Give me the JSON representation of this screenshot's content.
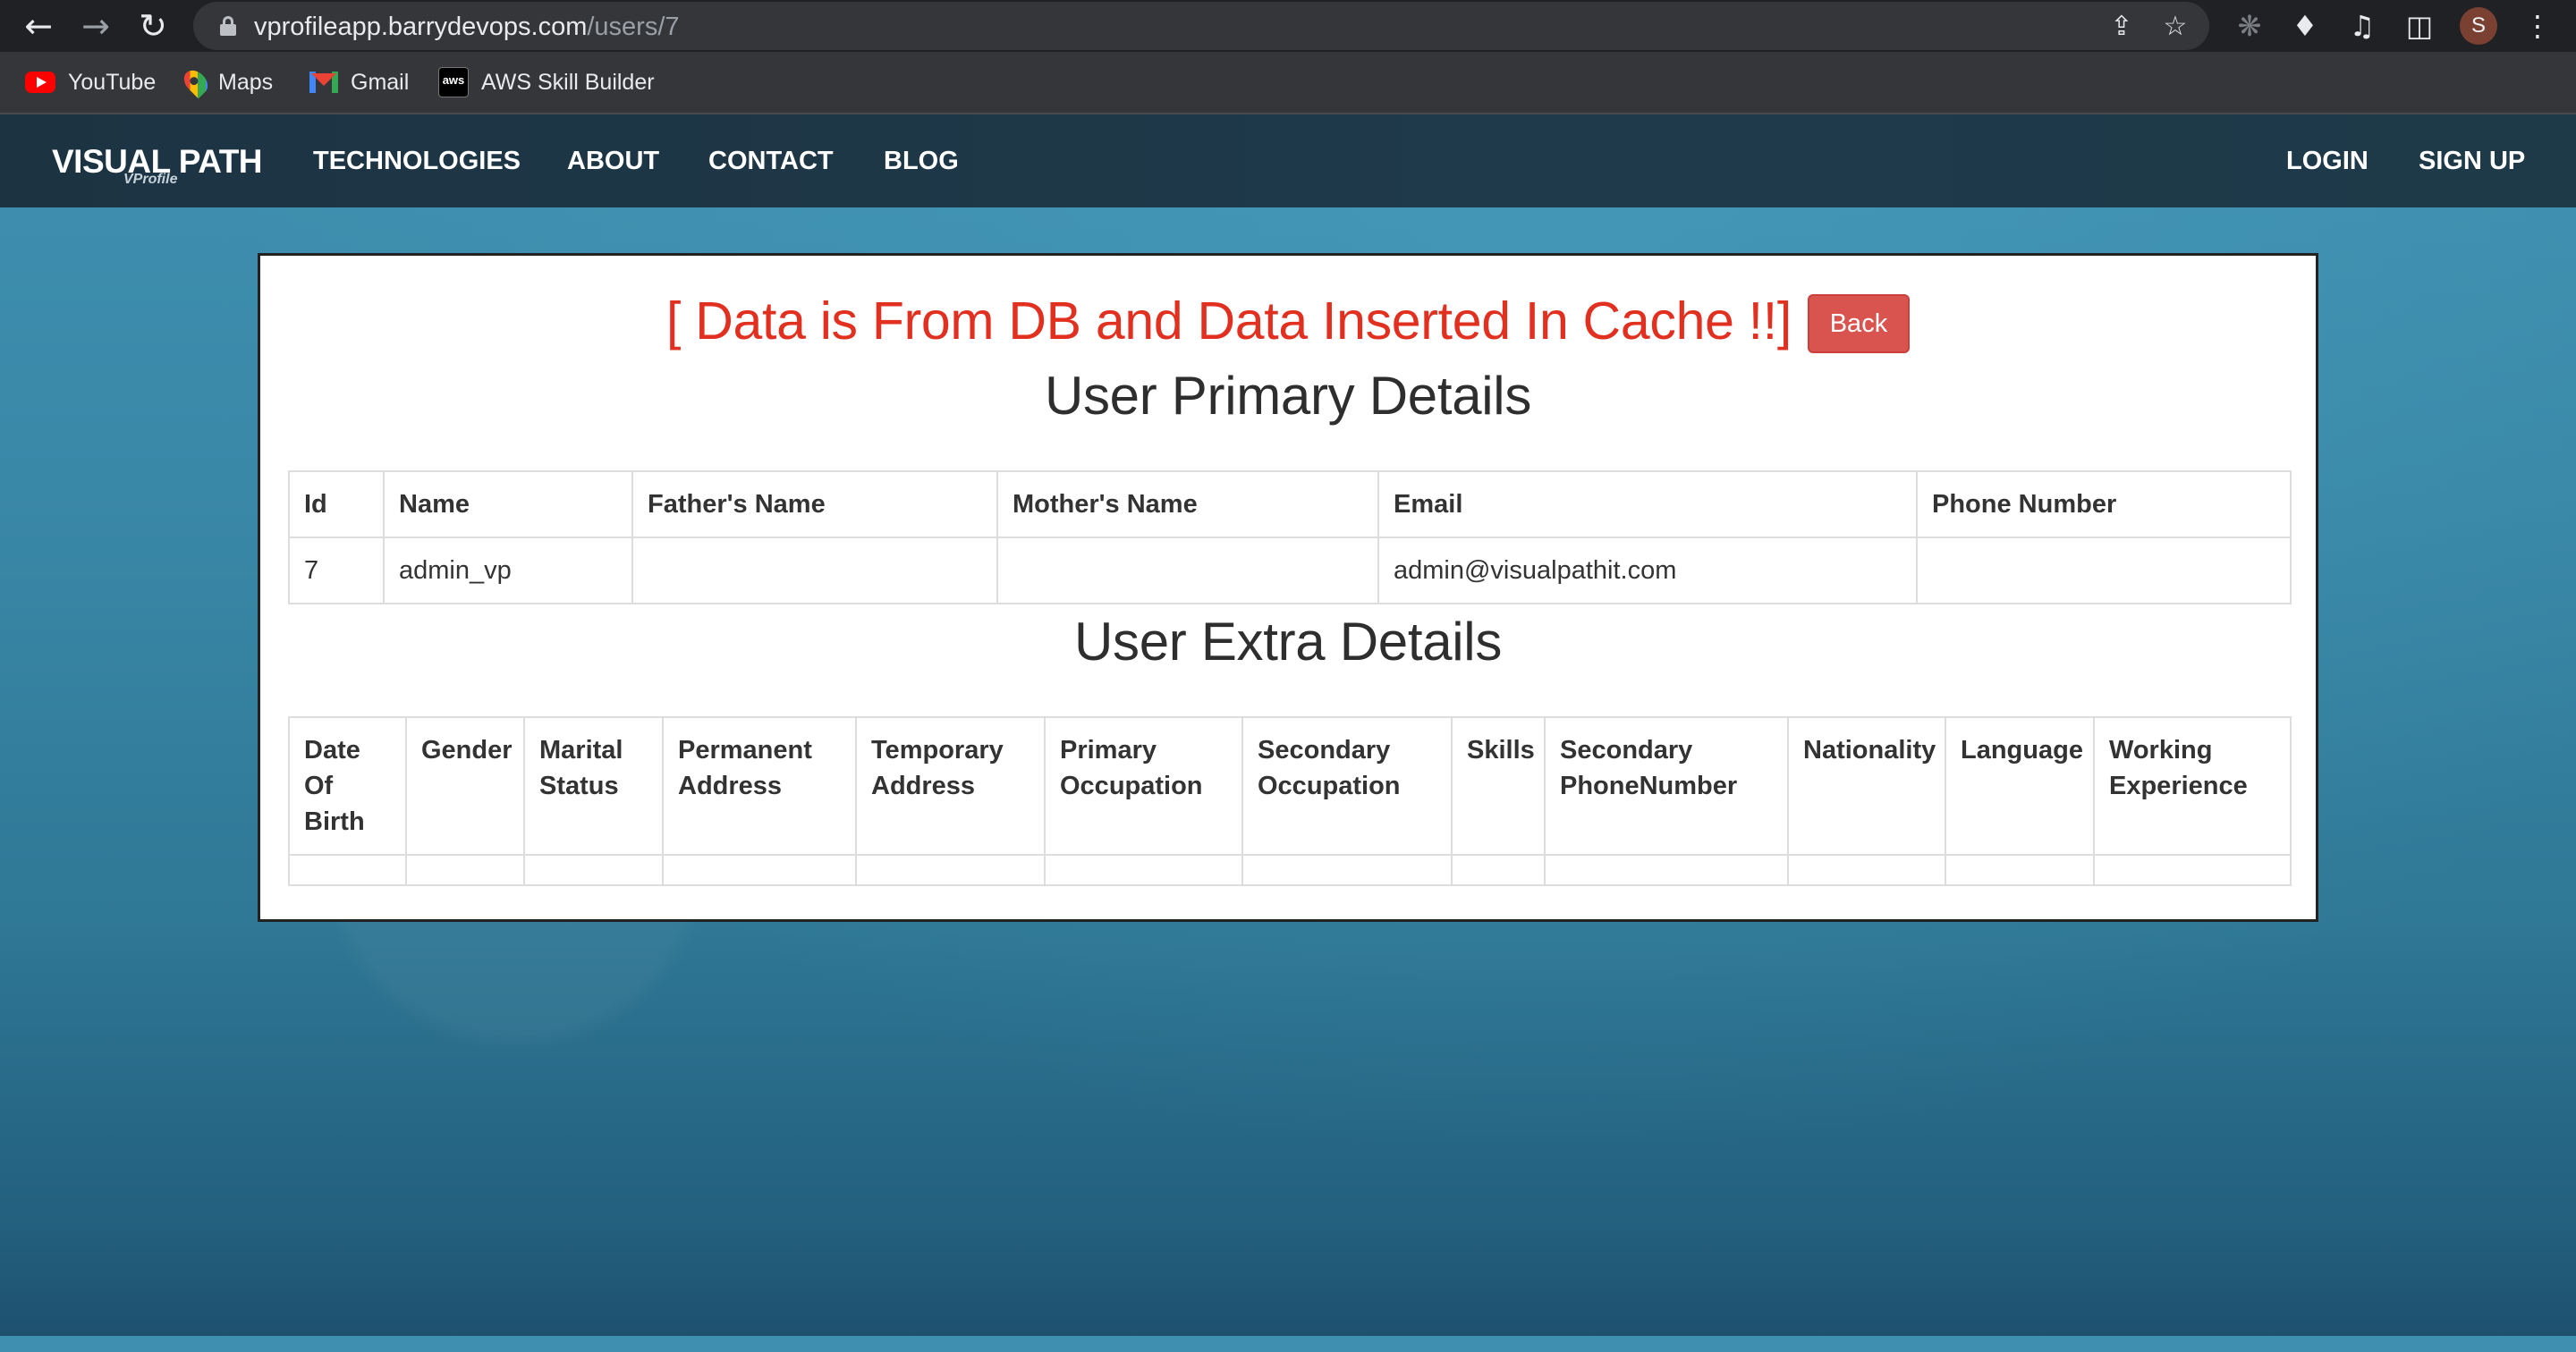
{
  "browser": {
    "url_host": "vprofileapp.barrydevops.com",
    "url_path": "/users/7",
    "profile_initial": "S",
    "bookmarks": [
      "YouTube",
      "Maps",
      "Gmail",
      "AWS Skill Builder"
    ],
    "aws_badge": "aws"
  },
  "site": {
    "brand": "VISUAL PATH",
    "brand_sub": "VProfile",
    "nav": [
      "TECHNOLOGIES",
      "ABOUT",
      "CONTACT",
      "BLOG"
    ],
    "auth": [
      "LOGIN",
      "SIGN UP"
    ]
  },
  "main": {
    "message": "[ Data is From DB and Data Inserted In Cache !!]",
    "back_label": "Back",
    "primary_title": "User Primary Details",
    "primary_headers": [
      "Id",
      "Name",
      "Father's Name",
      "Mother's Name",
      "Email",
      "Phone Number"
    ],
    "primary_row": [
      "7",
      "admin_vp",
      "",
      "",
      "admin@visualpathit.com",
      ""
    ],
    "extra_title": "User Extra Details",
    "extra_headers": [
      [
        "Date",
        "Of",
        "Birth"
      ],
      [
        "Gender"
      ],
      [
        "Marital",
        "Status"
      ],
      [
        "Permanent",
        "Address"
      ],
      [
        "Temporary",
        "Address"
      ],
      [
        "Primary",
        "Occupation"
      ],
      [
        "Secondary",
        "Occupation"
      ],
      [
        "Skills"
      ],
      [
        "Secondary",
        "PhoneNumber"
      ],
      [
        "Nationality"
      ],
      [
        "Language"
      ],
      [
        "Working",
        "Experience"
      ]
    ]
  },
  "colors": {
    "alert": "#e1301f",
    "back_button": "#d9534f",
    "nav_bg": "#1c3342",
    "page_bg": "#2e7896"
  }
}
